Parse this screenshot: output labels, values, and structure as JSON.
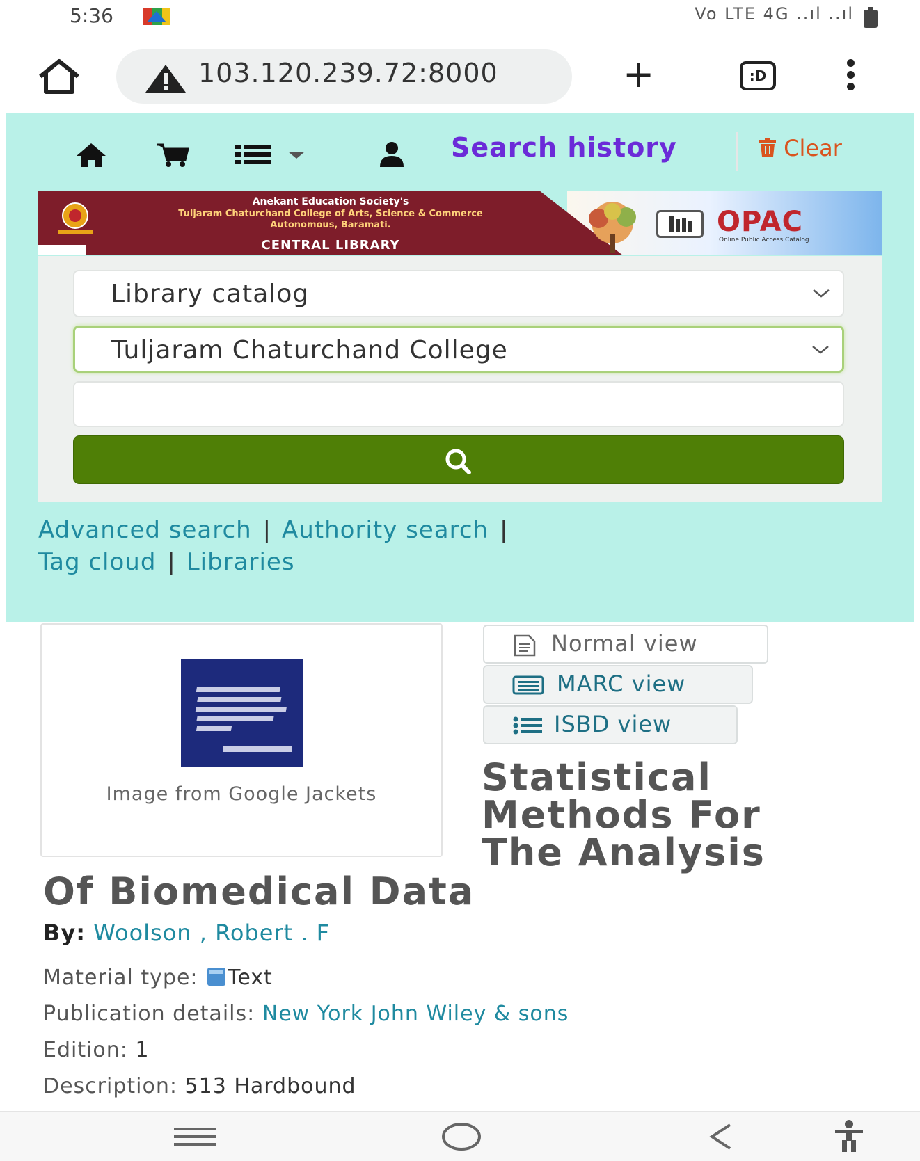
{
  "status_bar": {
    "time": "5:36",
    "right_text": "Vo LTE 4G ..ıl ..ıl",
    "flag_icon": "app-flag-icon"
  },
  "browser": {
    "url": "103.120.239.72:8000",
    "new_tab_label": "+",
    "tabs_label": ":D"
  },
  "header": {
    "nav_icons": [
      "home-icon",
      "cart-icon",
      "list-icon",
      "user-icon"
    ],
    "search_history": "Search history",
    "clear": "Clear"
  },
  "banner": {
    "society": "Anekant Education Society's",
    "college": "Tuljaram Chaturchand College of Arts, Science & Commerce",
    "autonomous": "Autonomous, Baramati.",
    "central_library": "CENTRAL LIBRARY",
    "opac": "OPAC",
    "opac_subtitle": "Online Public Access Catalog"
  },
  "search": {
    "catalog_select": "Library catalog",
    "library_select": "Tuljaram Chaturchand College",
    "query_value": ""
  },
  "links": {
    "advanced": "Advanced search",
    "authority": "Authority search",
    "tag_cloud": "Tag cloud",
    "libraries": "Libraries"
  },
  "record": {
    "cover_caption": "Image from Google Jackets",
    "views": {
      "normal": "Normal view",
      "marc": "MARC view",
      "isbd": "ISBD view"
    },
    "title_lines": [
      "Statistical",
      "Methods For",
      "The Analysis",
      "Of Biomedical Data"
    ],
    "by_label": "By:",
    "author": "Woolson , Robert . F",
    "material_type_label": "Material type:",
    "material_type": "Text",
    "publication_label": "Publication details:",
    "publication": "New York John Wiley & sons",
    "edition_label": "Edition:",
    "edition": "1",
    "description_label": "Description:",
    "description": "513 Hardbound"
  },
  "colors": {
    "header_bg": "#b9f1e8",
    "search_history": "#6b2bd8",
    "clear": "#d9541e",
    "search_button": "#4f7f06",
    "link": "#1f8aa0",
    "banner": "#7e1d2a"
  }
}
